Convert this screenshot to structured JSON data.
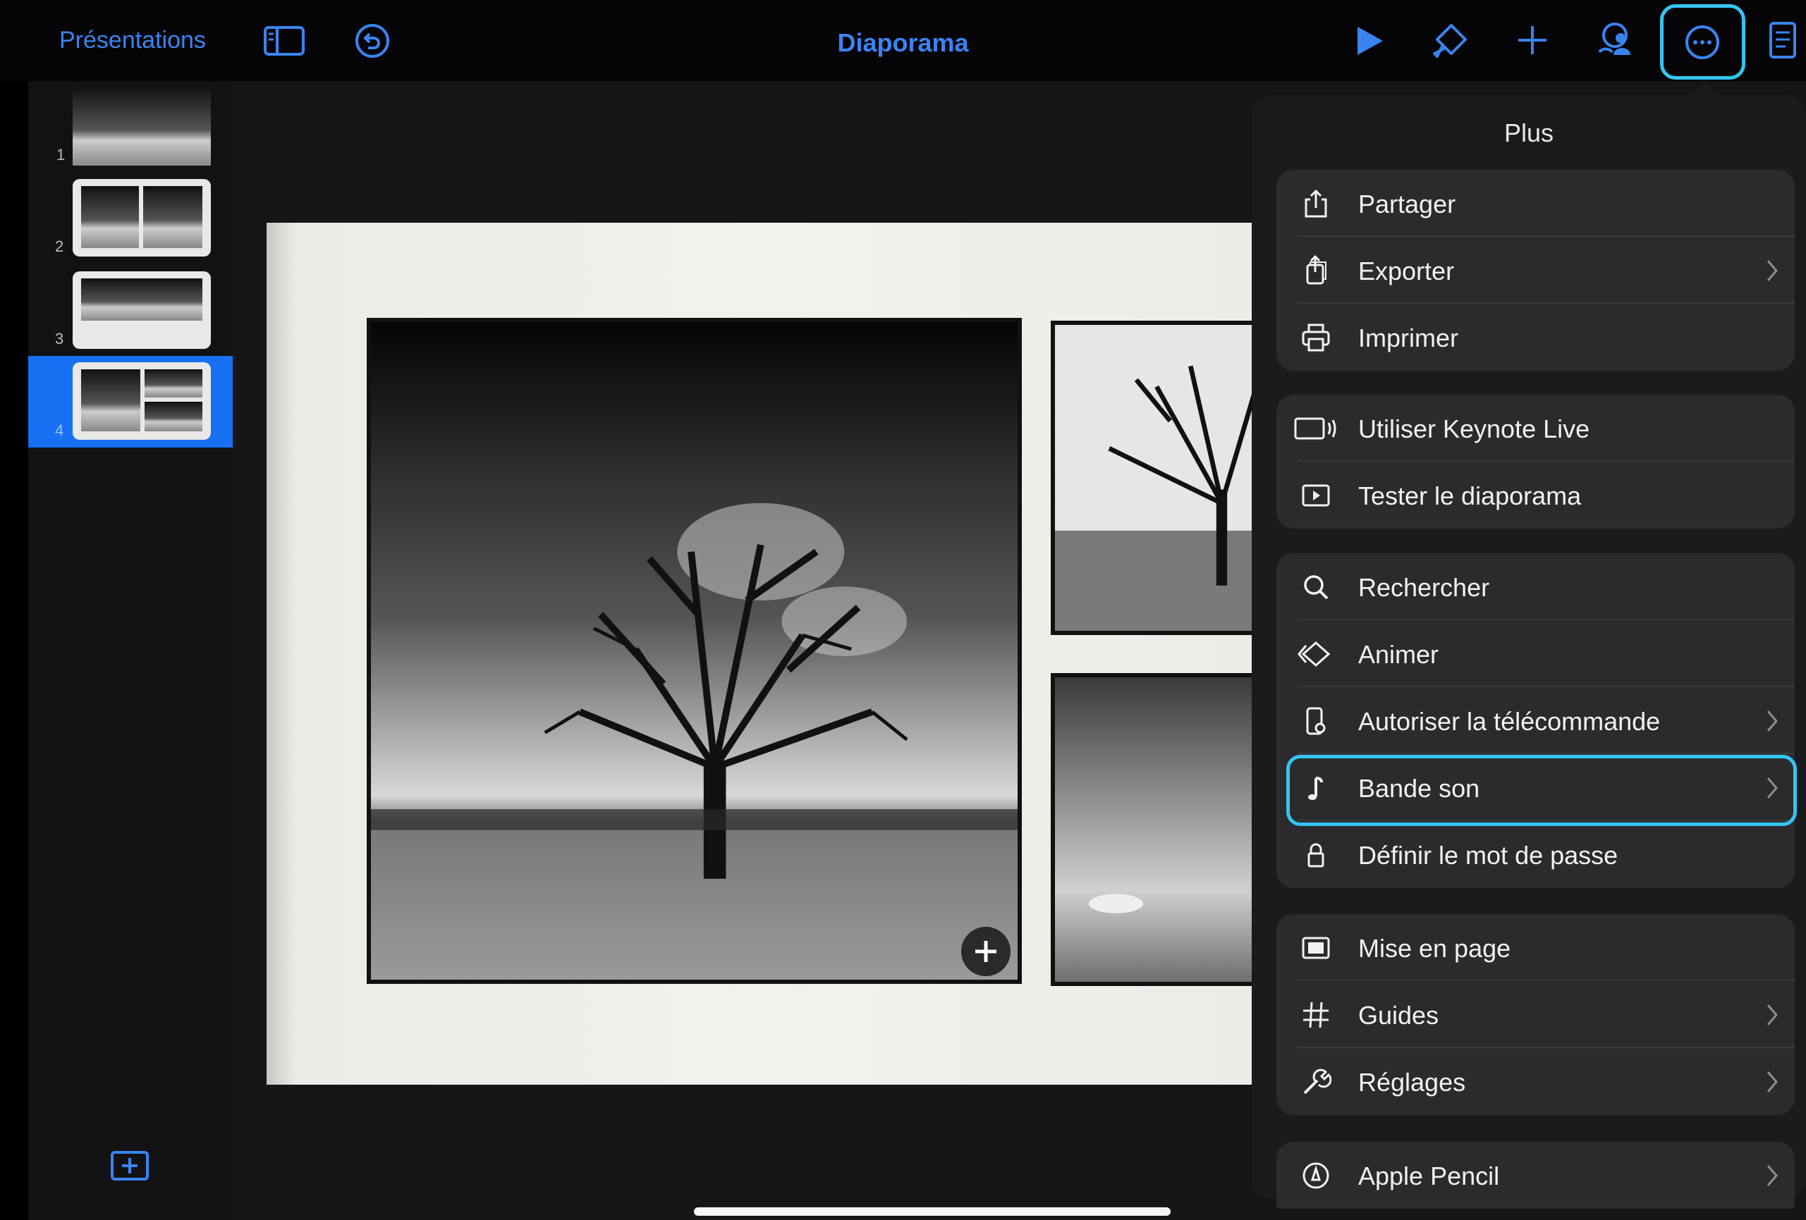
{
  "toolbar": {
    "back_label": "Présentations",
    "title": "Diaporama"
  },
  "navigator": {
    "slides": [
      {
        "number": "1"
      },
      {
        "number": "2"
      },
      {
        "number": "3"
      },
      {
        "number": "4"
      }
    ],
    "selected_slide": "4"
  },
  "popover": {
    "title": "Plus",
    "groups": [
      [
        {
          "label": "Partager",
          "icon": "share-icon",
          "chevron": false
        },
        {
          "label": "Exporter",
          "icon": "export-icon",
          "chevron": true
        },
        {
          "label": "Imprimer",
          "icon": "printer-icon",
          "chevron": false
        }
      ],
      [
        {
          "label": "Utiliser Keynote Live",
          "icon": "keynote-live-icon",
          "chevron": false
        },
        {
          "label": "Tester le diaporama",
          "icon": "play-rehearse-icon",
          "chevron": false
        }
      ],
      [
        {
          "label": "Rechercher",
          "icon": "search-icon",
          "chevron": false
        },
        {
          "label": "Animer",
          "icon": "animate-icon",
          "chevron": false
        },
        {
          "label": "Autoriser la télécommande",
          "icon": "remote-icon",
          "chevron": true
        },
        {
          "label": "Bande son",
          "icon": "music-note-icon",
          "chevron": true,
          "highlighted": true
        },
        {
          "label": "Définir le mot de passe",
          "icon": "lock-icon",
          "chevron": false
        }
      ],
      [
        {
          "label": "Mise en page",
          "icon": "layout-icon",
          "chevron": false
        },
        {
          "label": "Guides",
          "icon": "grid-hash-icon",
          "chevron": true
        },
        {
          "label": "Réglages",
          "icon": "wrench-icon",
          "chevron": true
        }
      ],
      [
        {
          "label": "Apple Pencil",
          "icon": "pencil-icon",
          "chevron": true
        }
      ]
    ]
  },
  "colors": {
    "accent": "#3a84f0",
    "highlight": "#34c5f2",
    "selection": "#1670f1"
  }
}
